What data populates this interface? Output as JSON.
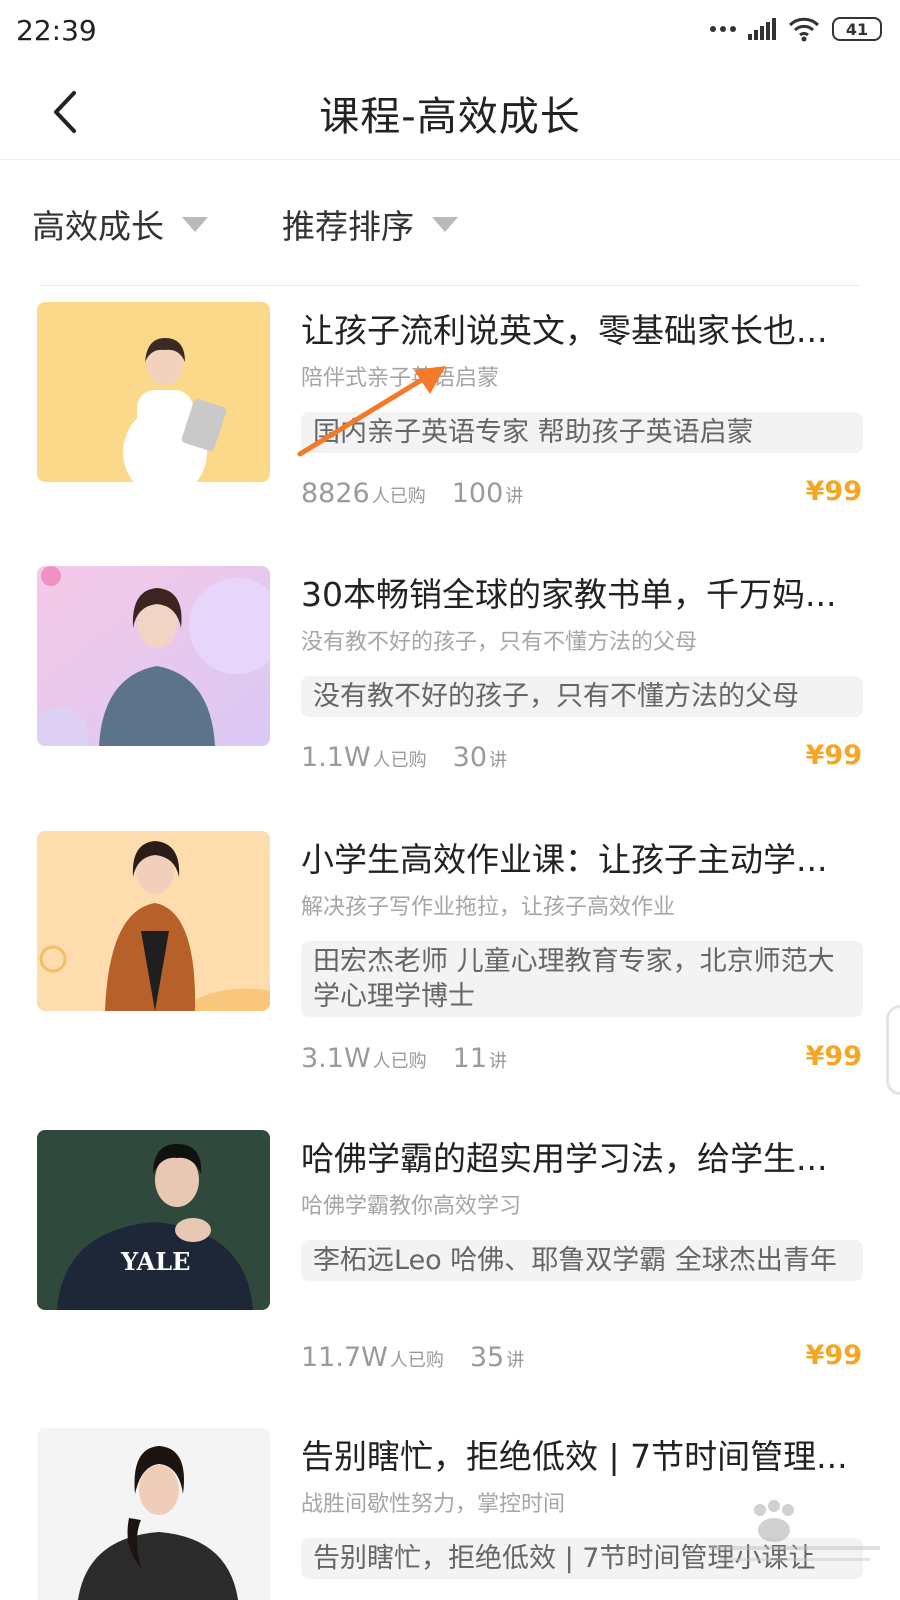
{
  "status_bar": {
    "time": "22:39",
    "battery": "41"
  },
  "nav": {
    "title": "课程-高效成长"
  },
  "filters": [
    {
      "label": "高效成长"
    },
    {
      "label": "推荐排序"
    }
  ],
  "courses": [
    {
      "title": "让孩子流利说英文，零基础家长也...",
      "subtitle": "陪伴式亲子英语启蒙",
      "tag": "国内亲子英语专家 帮助孩子英语启蒙",
      "buyers": "8826",
      "buyers_unit": "人已购",
      "lessons": "100",
      "lessons_unit": "讲",
      "price": "¥99",
      "thumb_bg": "#fcd98a"
    },
    {
      "title": "30本畅销全球的家教书单，千万妈...",
      "subtitle": "没有教不好的孩子，只有不懂方法的父母",
      "tag": "没有教不好的孩子，只有不懂方法的父母",
      "buyers": "1.1W",
      "buyers_unit": "人已购",
      "lessons": "30",
      "lessons_unit": "讲",
      "price": "¥99",
      "thumb_bg": "#e6c6ee"
    },
    {
      "title": "小学生高效作业课：让孩子主动学...",
      "subtitle": "解决孩子写作业拖拉，让孩子高效作业",
      "tag": "田宏杰老师 儿童心理教育专家，北京师范大学心理学博士",
      "buyers": "3.1W",
      "buyers_unit": "人已购",
      "lessons": "11",
      "lessons_unit": "讲",
      "price": "¥99",
      "thumb_bg": "#fddcae"
    },
    {
      "title": "哈佛学霸的超实用学习法，给学生...",
      "subtitle": "哈佛学霸教你高效学习",
      "tag": "李柘远Leo 哈佛、耶鲁双学霸  全球杰出青年",
      "buyers": "11.7W",
      "buyers_unit": "人已购",
      "lessons": "35",
      "lessons_unit": "讲",
      "price": "¥99",
      "thumb_bg": "#2f4a3c"
    },
    {
      "title": "告别瞎忙，拒绝低效 | 7节时间管理...",
      "subtitle": "战胜间歇性努力，掌控时间",
      "tag": "告别瞎忙，拒绝低效 | 7节时间管理小课让",
      "buyers": "",
      "buyers_unit": "",
      "lessons": "",
      "lessons_unit": "",
      "price": "",
      "thumb_bg": "#f4f4f4"
    }
  ],
  "icons": {
    "back": "chevron-left-icon",
    "dropdown": "triangle-down-icon",
    "annotation": "orange-arrow"
  },
  "colors": {
    "price": "#f6a623",
    "arrow": "#f47a2a"
  }
}
